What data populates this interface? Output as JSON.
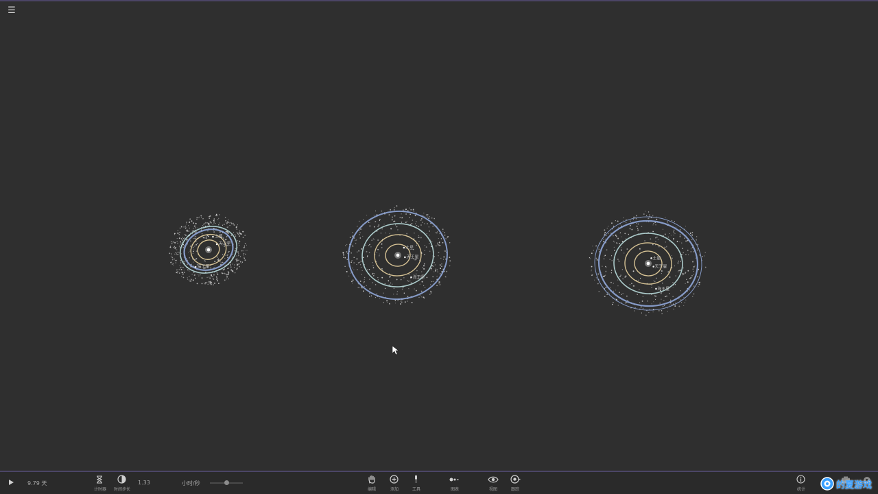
{
  "app": {
    "menu_icon": "hamburger-menu-icon"
  },
  "simulation": {
    "systems": [
      {
        "id": "system-1",
        "planet_labels": [
          "土星",
          "天王星",
          "海王星"
        ]
      },
      {
        "id": "system-2",
        "planet_labels": [
          "土星",
          "天王星",
          "海王星"
        ]
      },
      {
        "id": "system-3",
        "planet_labels": [
          "土星",
          "天王星",
          "海王星"
        ]
      }
    ]
  },
  "toolbar": {
    "play_icon": "play-icon",
    "elapsed_time": "9.79 天",
    "timer_label": "计时器",
    "time_step_label": "时间步长",
    "time_step_value": "1.33",
    "speed_unit": "小时/秒",
    "speed_slider_level": 0.5,
    "edit_label": "编辑",
    "add_label": "添加",
    "tools_label": "工具",
    "graph_label": "图表",
    "view_label": "视图",
    "follow_label": "跟踪",
    "stats_label": "统计"
  },
  "watermark": {
    "text": "的夏游戏"
  },
  "colors": {
    "background": "#2f2f2f",
    "toolbar": "#2a2a2a",
    "accent_line": "#4b4566",
    "orbit_blue": "#8fa6d8",
    "orbit_cyan": "#b9dcdc",
    "orbit_gold": "#e9d3a0",
    "watermark": "#3aa0ff"
  }
}
